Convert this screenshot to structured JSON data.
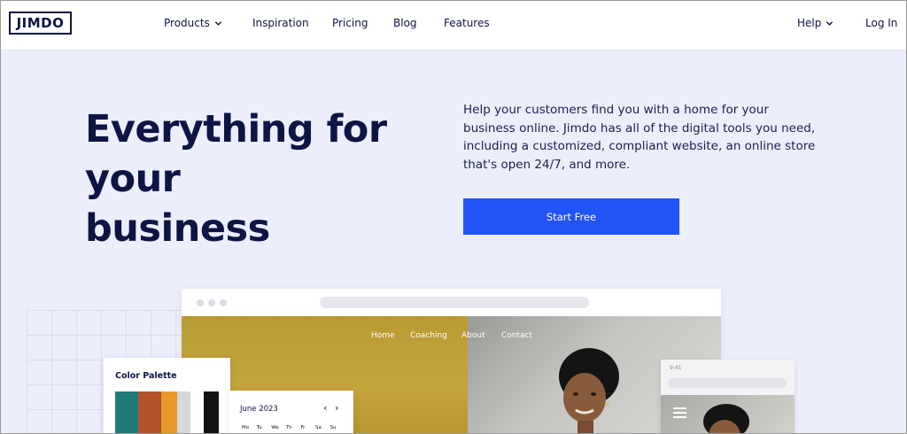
{
  "brand": {
    "logo_text": "JIMDO"
  },
  "nav": {
    "left": [
      {
        "label": "Products",
        "dropdown": true
      },
      {
        "label": "Inspiration",
        "dropdown": false
      },
      {
        "label": "Pricing",
        "dropdown": false
      },
      {
        "label": "Blog",
        "dropdown": false
      },
      {
        "label": "Features",
        "dropdown": false
      }
    ],
    "right": [
      {
        "label": "Help",
        "dropdown": true
      },
      {
        "label": "Log In",
        "dropdown": false
      }
    ]
  },
  "hero": {
    "title_line1": "Everything for your",
    "title_line2": "business",
    "description": "Help your customers find you with a home for your business online. Jimdo has all of the digital tools you need, including a customized, compliant website, an online store that's open 24/7, and more.",
    "cta_label": "Start Free"
  },
  "mockup": {
    "site_nav": [
      "Home",
      "Coaching",
      "About",
      "Contact"
    ]
  },
  "palette": {
    "title": "Color Palette",
    "colors": [
      "#1f7a78",
      "#b4512d",
      "#e7992c",
      "#d7d7d7",
      "#ffffff",
      "#111111"
    ]
  },
  "calendar": {
    "month": "June 2023",
    "prev": "‹",
    "next": "›",
    "days": [
      "Mo",
      "Tu",
      "We",
      "Th",
      "Fr",
      "Sa",
      "Su"
    ]
  },
  "phone": {
    "time": "9:41"
  },
  "colors": {
    "accent": "#2253f5",
    "navy": "#0e1545",
    "hero_bg": "#eceefc"
  }
}
